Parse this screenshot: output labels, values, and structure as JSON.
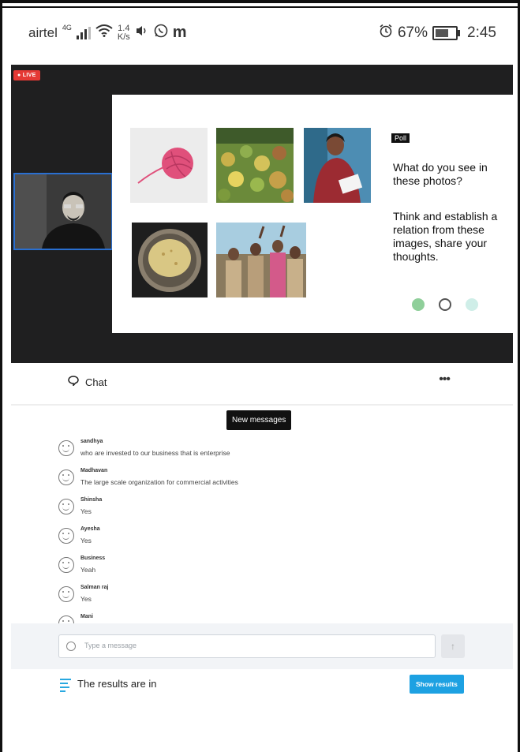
{
  "status_bar": {
    "carrier": "airtel",
    "network": "4G",
    "speed_value": "1.4",
    "speed_unit": "K/s",
    "battery": "67%",
    "time": "2:45"
  },
  "video": {
    "live_label": "LIVE",
    "slide": {
      "tag": "Poll",
      "question": "What do you see in these photos?",
      "prompt": "Think and establish a relation from these images, share your thoughts."
    }
  },
  "chat": {
    "title": "Chat",
    "more": "•••",
    "new_messages": "New messages",
    "messages": [
      {
        "name": "sandhya",
        "text": "who are invested to our business that is enterprise"
      },
      {
        "name": "Madhavan",
        "text": "The large scale organization for commercial activities"
      },
      {
        "name": "Shinsha",
        "text": "Yes"
      },
      {
        "name": "Ayesha",
        "text": "Yes"
      },
      {
        "name": "Business",
        "text": "Yeah"
      },
      {
        "name": "Salman raj",
        "text": "Yes"
      },
      {
        "name": "Mani",
        "text": ""
      }
    ],
    "input_placeholder": "Type a message"
  },
  "results": {
    "text": "The results are in",
    "button": "Show results"
  },
  "colors": {
    "accent": "#1da1e2",
    "live": "#e53935",
    "camera_border": "#2a6fd0"
  }
}
